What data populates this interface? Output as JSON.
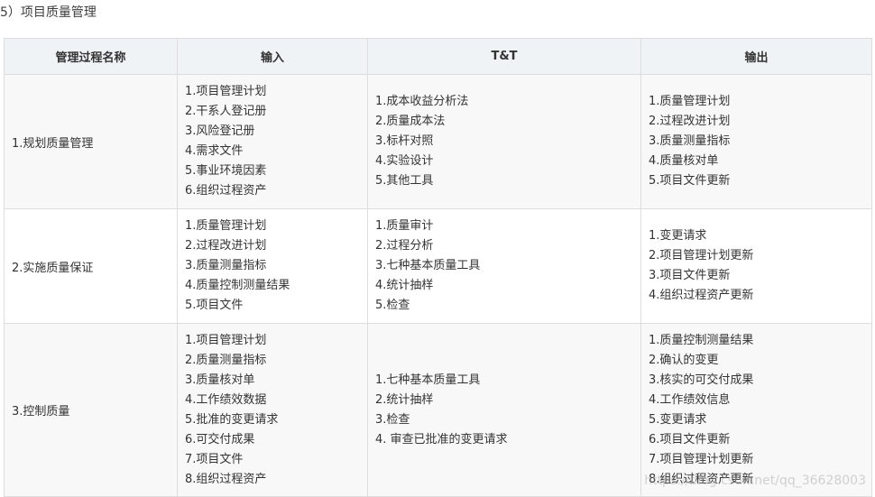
{
  "heading": "5）项目质量管理",
  "table": {
    "headers": [
      "管理过程名称",
      "输入",
      "T&T",
      "输出"
    ],
    "rows": [
      {
        "name": "1.规划质量管理",
        "inputs": [
          "1.项目管理计划",
          "2.干系人登记册",
          "3.风险登记册",
          "4.需求文件",
          "5.事业环境因素",
          "6.组织过程资产"
        ],
        "tools": [
          "1.成本收益分析法",
          "2.质量成本法",
          "3.标杆对照",
          "4.实验设计",
          "5.其他工具"
        ],
        "outputs": [
          "1.质量管理计划",
          "2.过程改进计划",
          "3.质量测量指标",
          "4.质量核对单",
          "5.项目文件更新"
        ]
      },
      {
        "name": "2.实施质量保证",
        "inputs": [
          "1.质量管理计划",
          "2.过程改进计划",
          "3.质量测量指标",
          "4.质量控制测量结果",
          "5.项目文件"
        ],
        "tools": [
          "1.质量审计",
          "2.过程分析",
          "3.七种基本质量工具",
          "4.统计抽样",
          "5.检查"
        ],
        "outputs": [
          "1.变更请求",
          "2.项目管理计划更新",
          "3.项目文件更新",
          "4.组织过程资产更新"
        ]
      },
      {
        "name": "3.控制质量",
        "inputs": [
          "1.项目管理计划",
          "2.质量测量指标",
          "3.质量核对单",
          "4.工作绩效数据",
          "5.批准的变更请求",
          "6.可交付成果",
          "7.项目文件",
          "8.组织过程资产"
        ],
        "tools": [
          "1.七种基本质量工具",
          "2.统计抽样",
          "3.检查",
          "4. 审查已批准的变更请求"
        ],
        "outputs": [
          "1.质量控制测量结果",
          "2.确认的变更",
          "3.核实的可交付成果",
          "4.工作绩效信息",
          "5.变更请求",
          "6.项目文件更新",
          "7.项目管理计划更新",
          "8.组织过程资产更新"
        ]
      }
    ]
  },
  "watermark": "https://blog.csdn.net/qq_36628003"
}
